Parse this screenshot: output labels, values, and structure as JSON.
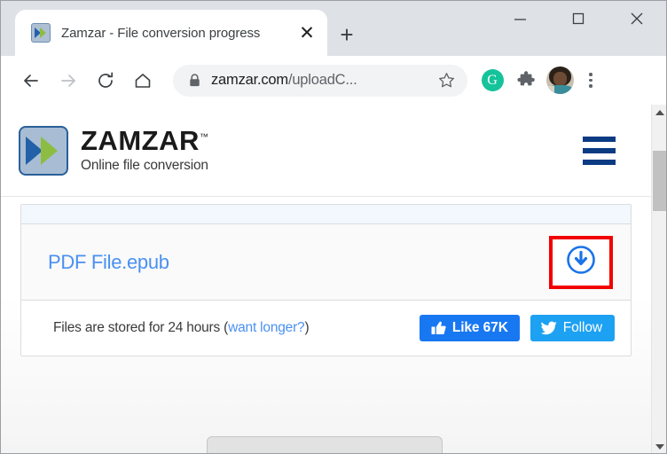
{
  "browser": {
    "tab": {
      "title": "Zamzar - File conversion progress",
      "favicon": "zamzar-favicon",
      "close_label": "✕"
    },
    "new_tab_label": "+",
    "window_controls": {
      "minimize": "minimize-icon",
      "maximize": "maximize-icon",
      "close": "close-icon"
    },
    "toolbar": {
      "back": "back-arrow-icon",
      "forward": "forward-arrow-icon",
      "reload": "reload-icon",
      "home": "home-icon",
      "lock": "lock-icon",
      "url_domain": "zamzar.com",
      "url_path": "/uploadC...",
      "bookmark": "star-icon",
      "grammarly": "G",
      "extensions": "puzzle-piece-icon",
      "profile": "avatar",
      "menu": "three-dot-menu-icon"
    }
  },
  "site": {
    "logo": {
      "word": "ZAMZAR",
      "tm": "™",
      "tagline": "Online file conversion"
    },
    "menu_label": "hamburger-menu"
  },
  "content": {
    "file_name": "PDF File.epub",
    "download_icon": "download-circle-icon",
    "footer_text_before": "Files are stored for 24 hours (",
    "footer_link": "want longer?",
    "footer_text_after": ")",
    "like_button": "Like 67K",
    "follow_button": "Follow"
  },
  "colors": {
    "accent_blue": "#4a90f2",
    "highlight_red": "#f20000",
    "facebook_blue": "#1878f2",
    "twitter_blue": "#1da1f2",
    "nav_navy": "#0b3b83",
    "grammarly_green": "#15c39a"
  }
}
